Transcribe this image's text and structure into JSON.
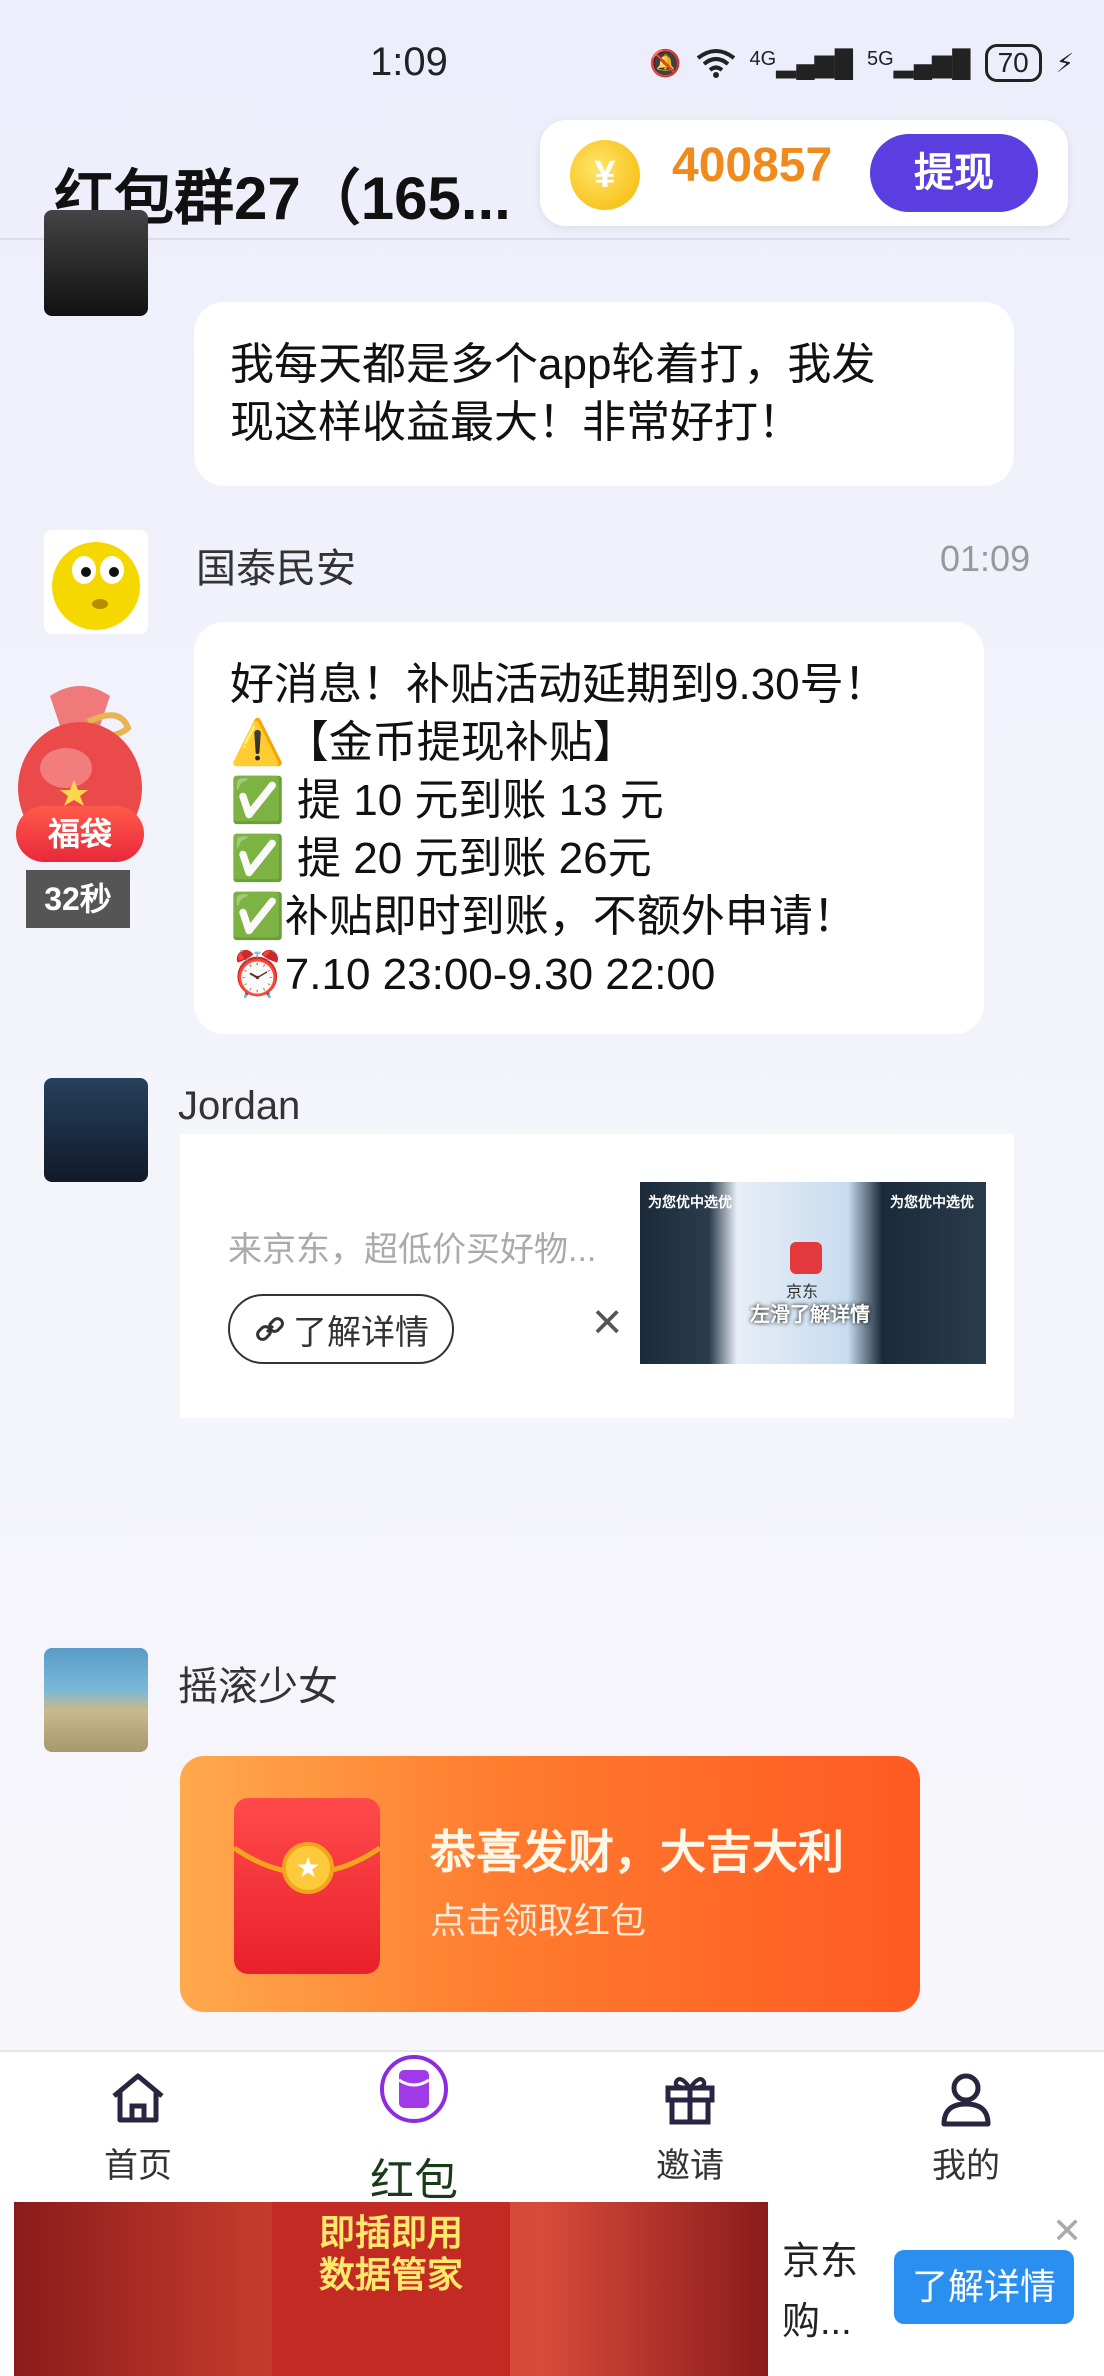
{
  "status": {
    "time": "1:09",
    "signal1": "4G",
    "signal2": "5G",
    "battery": "70"
  },
  "header": {
    "title": "红包群27（165...",
    "coin_symbol": "¥",
    "coin_amount": "400857",
    "withdraw_label": "提现"
  },
  "messages": [
    {
      "text_lines": [
        "我每天都是多个app轮着打，我发",
        "现这样收益最大！非常好打！"
      ]
    },
    {
      "name": "国泰民安",
      "time": "01:09",
      "text_lines": [
        "好消息！补贴活动延期到9.30号！",
        "⚠️【金币提现补贴】",
        "✅ 提 10 元到账 13 元",
        "✅ 提 20 元到账 26元",
        "✅补贴即时到账，不额外申请！",
        "⏰7.10 23:00-9.30 22:00"
      ]
    },
    {
      "name": "Jordan",
      "ad": {
        "subtitle": "来京东，超低价买好物...",
        "button": "了解详情",
        "close": "×",
        "image_caption": "左滑了解详情",
        "image_brand": "京东",
        "promo_left": "为您优中选优",
        "promo_right": "为您优中选优"
      }
    },
    {
      "name": "摇滚少女",
      "redpacket": {
        "title": "恭喜发财，大吉大利",
        "subtitle": "点击领取红包",
        "seal": "★"
      }
    }
  ],
  "lucky_bag": {
    "label": "福袋",
    "timer": "32秒"
  },
  "nav": [
    {
      "label": "首页",
      "icon": "home-icon"
    },
    {
      "label": "红包",
      "icon": "red-packet-icon"
    },
    {
      "label": "邀请",
      "icon": "gift-icon"
    },
    {
      "label": "我的",
      "icon": "profile-icon"
    }
  ],
  "bottom_ad": {
    "promo": "即插即用\n数据管家",
    "title_line1": "京东",
    "title_line2": "购...",
    "button": "了解详情",
    "close": "✕"
  },
  "colors": {
    "accent": "#5a3ee0",
    "coin": "#f08a1c",
    "redpacket": "#ff6a2a",
    "ad_button": "#2b8ff0"
  }
}
